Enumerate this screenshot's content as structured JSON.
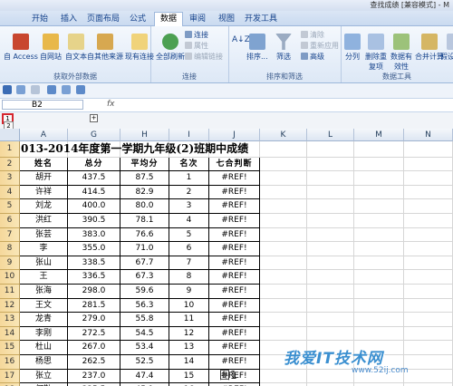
{
  "window": {
    "title": "查找成绩 [兼容模式] - M"
  },
  "tabs": [
    "开始",
    "插入",
    "页面布局",
    "公式",
    "数据",
    "审阅",
    "视图",
    "开发工具"
  ],
  "active_tab": "数据",
  "ribbon": {
    "get_external": {
      "label": "获取外部数据",
      "access": "自 Access",
      "web": "自网站",
      "text": "自文本",
      "other": "自其他来源",
      "existing": "现有连接"
    },
    "connections": {
      "label": "连接",
      "refresh_all": "全部刷新",
      "conn": "连接",
      "props": "属性",
      "edit_links": "编辑链接"
    },
    "sort_filter": {
      "label": "排序和筛选",
      "sort": "排序...",
      "filter": "筛选",
      "clear": "清除",
      "reapply": "重新应用",
      "advanced": "高级"
    },
    "data_tools": {
      "label": "数据工具",
      "text_to_cols": "分列",
      "remove_dups": "删除重复项",
      "validation": "数据有效性",
      "consolidate": "合并计算",
      "whatif": "假设分析"
    }
  },
  "formula_bar": {
    "name_box": "B2",
    "fx": "fx"
  },
  "outline": {
    "levels": [
      "1",
      "2"
    ],
    "expand": "+"
  },
  "columns": [
    "A",
    "G",
    "H",
    "I",
    "J",
    "K",
    "L",
    "M",
    "N"
  ],
  "title_text": "013-2014年度第一学期九年级(2)班期中成绩",
  "headers": [
    "姓名",
    "总分",
    "平均分",
    "名次",
    "七合判断"
  ],
  "rows": [
    {
      "n": "3",
      "name": "胡开",
      "total": "437.5",
      "avg": "87.5",
      "rank": "1",
      "flag": "#REF!"
    },
    {
      "n": "4",
      "name": "许祥",
      "total": "414.5",
      "avg": "82.9",
      "rank": "2",
      "flag": "#REF!"
    },
    {
      "n": "5",
      "name": "刘龙",
      "total": "400.0",
      "avg": "80.0",
      "rank": "3",
      "flag": "#REF!"
    },
    {
      "n": "6",
      "name": "洪红",
      "total": "390.5",
      "avg": "78.1",
      "rank": "4",
      "flag": "#REF!"
    },
    {
      "n": "7",
      "name": "张芸",
      "total": "383.0",
      "avg": "76.6",
      "rank": "5",
      "flag": "#REF!"
    },
    {
      "n": "8",
      "name": "李",
      "total": "355.0",
      "avg": "71.0",
      "rank": "6",
      "flag": "#REF!"
    },
    {
      "n": "9",
      "name": "张山",
      "total": "338.5",
      "avg": "67.7",
      "rank": "7",
      "flag": "#REF!"
    },
    {
      "n": "10",
      "name": "王",
      "total": "336.5",
      "avg": "67.3",
      "rank": "8",
      "flag": "#REF!"
    },
    {
      "n": "11",
      "name": "张海",
      "total": "298.0",
      "avg": "59.6",
      "rank": "9",
      "flag": "#REF!"
    },
    {
      "n": "12",
      "name": "王文",
      "total": "281.5",
      "avg": "56.3",
      "rank": "10",
      "flag": "#REF!"
    },
    {
      "n": "13",
      "name": "龙青",
      "total": "279.0",
      "avg": "55.8",
      "rank": "11",
      "flag": "#REF!"
    },
    {
      "n": "14",
      "name": "李刚",
      "total": "272.5",
      "avg": "54.5",
      "rank": "12",
      "flag": "#REF!"
    },
    {
      "n": "15",
      "name": "杜山",
      "total": "267.0",
      "avg": "53.4",
      "rank": "13",
      "flag": "#REF!"
    },
    {
      "n": "16",
      "name": "杨思",
      "total": "262.5",
      "avg": "52.5",
      "rank": "14",
      "flag": "#REF!"
    },
    {
      "n": "17",
      "name": "张立",
      "total": "237.0",
      "avg": "47.4",
      "rank": "15",
      "flag": "#REF!"
    },
    {
      "n": "18",
      "name": "何勤",
      "total": "225.5",
      "avg": "45.1",
      "rank": "16",
      "flag": "#REF!"
    }
  ],
  "watermark": {
    "brand": "我爱IT技术网",
    "url": "www.52ij.com",
    "fig": "图1"
  }
}
